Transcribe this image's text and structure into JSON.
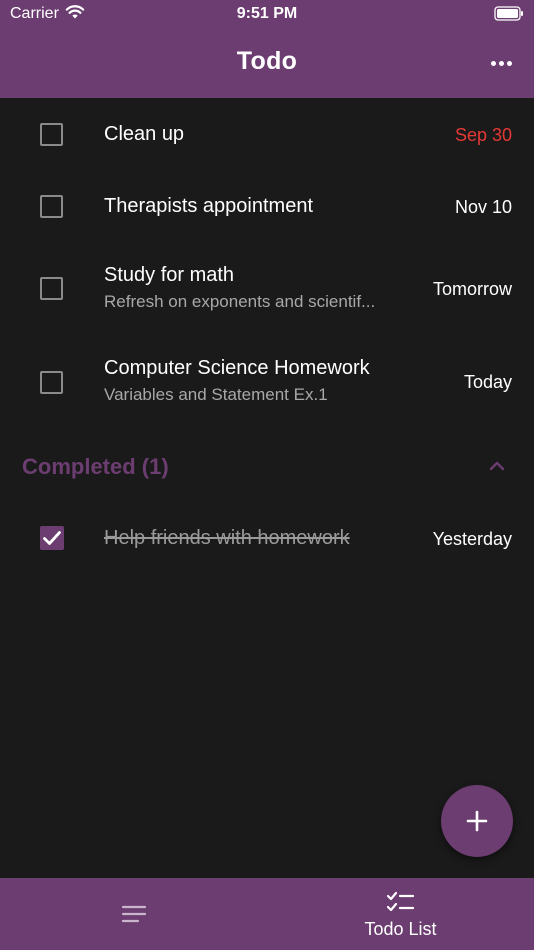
{
  "status_bar": {
    "carrier": "Carrier",
    "time": "9:51 PM"
  },
  "app_bar": {
    "title": "Todo",
    "more_icon": "more-horizontal-icon"
  },
  "todos": [
    {
      "title": "Clean up",
      "subtitle": "",
      "date": "Sep 30",
      "date_color": "#e53935",
      "checked": false
    },
    {
      "title": "Therapists appointment",
      "subtitle": "",
      "date": "Nov 10",
      "checked": false
    },
    {
      "title": "Study for math",
      "subtitle": "Refresh on exponents and scientif...",
      "date": "Tomorrow",
      "checked": false
    },
    {
      "title": "Computer Science Homework",
      "subtitle": "Variables and Statement Ex.1",
      "date": "Today",
      "checked": false
    }
  ],
  "completed": {
    "label": "Completed (1)",
    "collapse_icon": "chevron-up-icon",
    "items": [
      {
        "title": "Help friends with homework",
        "date": "Yesterday",
        "checked": true
      }
    ]
  },
  "fab": {
    "icon": "plus-icon"
  },
  "bottom_nav": {
    "items": [
      {
        "label": "",
        "icon": "menu-lines-icon"
      },
      {
        "label": "Todo List",
        "icon": "checklist-icon"
      }
    ]
  },
  "colors": {
    "primary": "#6c3d70",
    "background": "#1b1a1b",
    "overdue": "#e53935"
  }
}
